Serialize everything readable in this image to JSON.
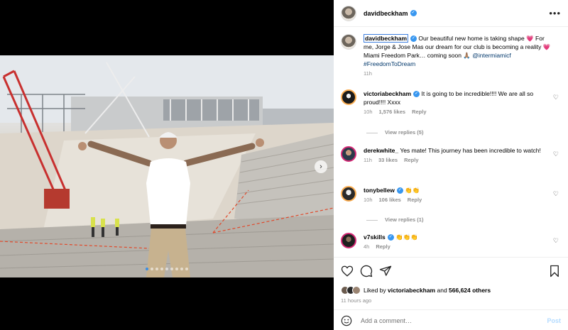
{
  "post": {
    "author": "davidbeckham",
    "more_icon": "more-horizontal-icon"
  },
  "caption": {
    "username": "davidbeckham",
    "text_1": " Our beautiful new home is taking shape 💗 For me, Jorge & Jose Mas our dream for our club is becoming a reality 💗 Miami Freedom Park… coming soon 🙏🏽 ",
    "mention": "@intermiamicf",
    "hashtag": "#FreedomToDream",
    "time": "11h"
  },
  "comments": [
    {
      "username": "victoriabeckham",
      "verified": true,
      "text": "It is going to be incredible!!!! We are all so proud!!!! Xxxx",
      "time": "10h",
      "likes": "1,576 likes",
      "reply": "Reply",
      "view_replies": "View replies (5)"
    },
    {
      "username": "derekwhite_",
      "verified": false,
      "text": "Yes mate! This journey has been incredible to watch!",
      "time": "11h",
      "likes": "33 likes",
      "reply": "Reply"
    },
    {
      "username": "tonybellew",
      "verified": true,
      "text": "👏👏",
      "time": "10h",
      "likes": "106 likes",
      "reply": "Reply",
      "view_replies": "View replies (1)"
    },
    {
      "username": "v7skills",
      "verified": true,
      "text": "👏👏👏",
      "time": "4h",
      "reply": "Reply"
    }
  ],
  "likes": {
    "prefix": "Liked by ",
    "user": "victoriabeckham",
    "middle": " and ",
    "count": "566,624 others"
  },
  "timestamp": "11 hours ago",
  "add_comment": {
    "placeholder": "Add a comment…",
    "post_label": "Post"
  },
  "carousel": {
    "current": 1,
    "total": 9
  }
}
